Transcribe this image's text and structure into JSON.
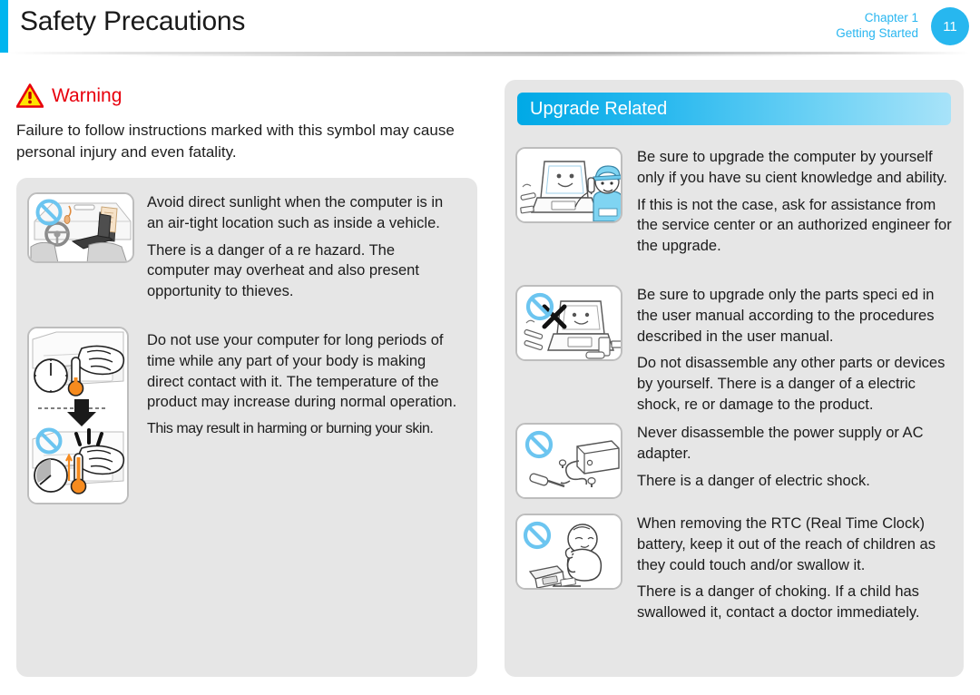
{
  "header": {
    "title": "Safety Precautions",
    "chapter": "Chapter 1",
    "section": "Getting Started",
    "page_number": "11",
    "accent_color": "#00b5ef",
    "badge_color": "#27b7ef"
  },
  "warning": {
    "label": "Warning",
    "label_color": "#e8000d",
    "description": "Failure to follow instructions marked with this symbol may cause personal injury and even fatality."
  },
  "left_panel": {
    "items": [
      {
        "icon": "car-interior-laptop-no-sunlight-icon",
        "paragraphs": [
          "Avoid direct sunlight when the computer is in an air-tight location such as inside a vehicle.",
          "There is a danger of a  re hazard. The computer may overheat and also present opportunity to thieves."
        ]
      },
      {
        "icon": "hand-on-laptop-heat-thermometer-icon",
        "paragraphs": [
          "Do not use your computer for long periods of time while any part of your body is making direct contact with it. The temperature of the product may increase during normal operation.",
          "This may result in harming or burning your skin."
        ]
      }
    ]
  },
  "right_panel": {
    "section_title": "Upgrade Related",
    "section_gradient_from": "#00a9e6",
    "section_gradient_to": "#a8e3f9",
    "items": [
      {
        "icon": "technician-phone-laptop-icon",
        "paragraphs": [
          "Be sure to upgrade the computer by yourself only if you have su cient knowledge and ability.",
          "If this is not the case, ask for assistance from the service center or an authorized engineer for the upgrade."
        ]
      },
      {
        "icon": "no-disassemble-laptop-tools-icon",
        "paragraphs": [
          "Be sure to upgrade only the parts speci ed in the user manual according to the procedures described in the user manual.",
          "Do not disassemble any other parts or devices by yourself. There is a danger of a electric shock,  re or damage to the product."
        ]
      },
      {
        "icon": "no-disassemble-ac-adapter-icon",
        "paragraphs": [
          "Never disassemble the power supply or AC adapter.",
          "There is a danger of electric shock."
        ]
      },
      {
        "icon": "no-child-swallow-battery-icon",
        "paragraphs": [
          "When removing the RTC (Real Time Clock) battery, keep it out of the reach of children as they could touch and/or swallow it.",
          "There is a danger of choking. If a child has swallowed it, contact a doctor immediately."
        ]
      }
    ]
  }
}
